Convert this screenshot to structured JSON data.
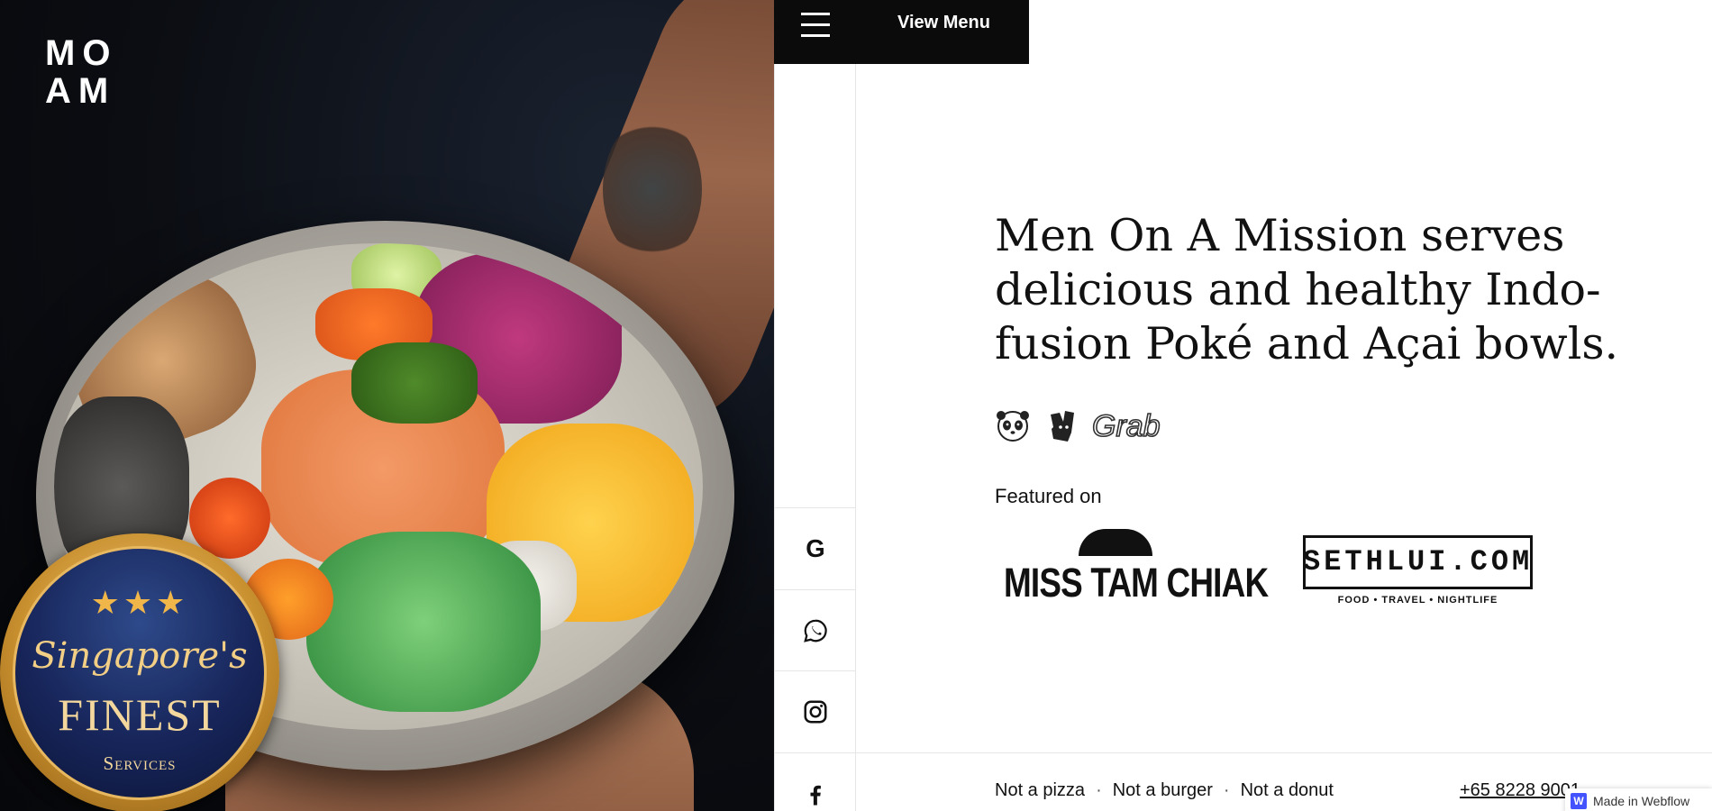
{
  "brand": {
    "logo_line1": "MO",
    "logo_line2": "AM"
  },
  "topbar": {
    "menu_label": "View Menu",
    "menu_icon": "hamburger-icon"
  },
  "badge": {
    "stars": "★★★",
    "script": "Singapore's",
    "title": "FINEST",
    "subtitle": "Services"
  },
  "social": [
    {
      "name": "google-icon"
    },
    {
      "name": "whatsapp-icon"
    },
    {
      "name": "instagram-icon"
    },
    {
      "name": "facebook-icon"
    }
  ],
  "hero": {
    "headline": "Men On A Mission serves delicious and healthy Indo-fusion Poké and Açai bowls."
  },
  "delivery": {
    "icons": [
      "foodpanda-icon",
      "deliveroo-icon",
      "grab-icon"
    ],
    "grab_label": "Grab"
  },
  "featured": {
    "label": "Featured on",
    "misstamchiak": {
      "name": "MISS TAM CHIAK"
    },
    "sethlui": {
      "name": "SETHLUI.COM",
      "tagline": "FOOD • TRAVEL • NIGHTLIFE"
    }
  },
  "footer": {
    "nots": [
      "Not a pizza",
      "Not a burger",
      "Not a donut"
    ],
    "separator": "·",
    "phone": "+65 8228 9001"
  },
  "webflow": {
    "label": "Made in Webflow",
    "icon_letter": "W"
  }
}
